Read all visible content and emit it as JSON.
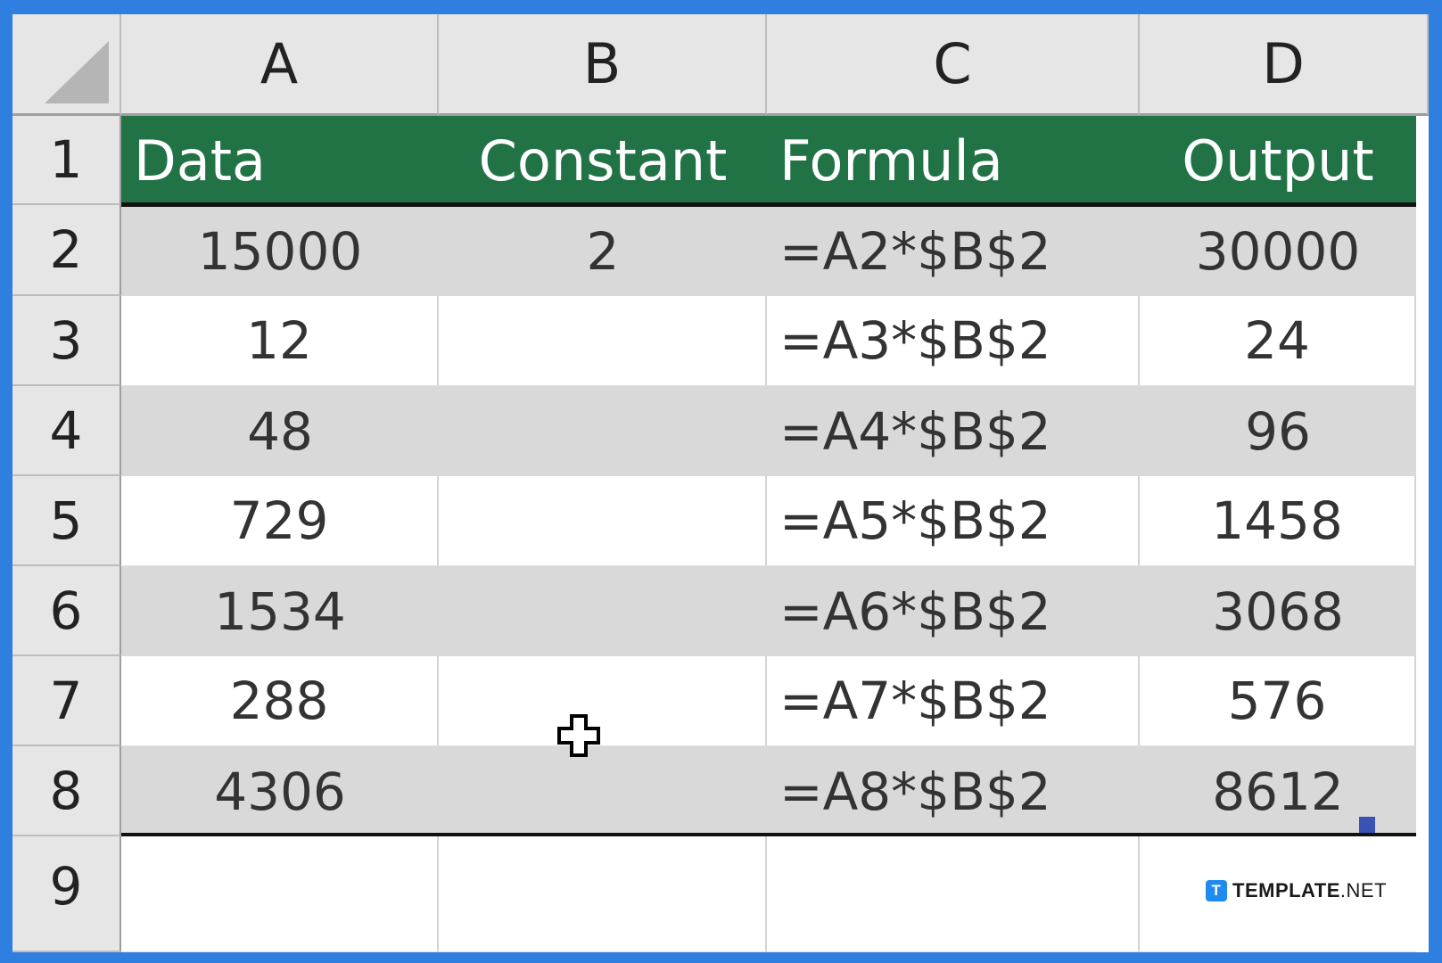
{
  "columns": [
    "A",
    "B",
    "C",
    "D"
  ],
  "rows": [
    "1",
    "2",
    "3",
    "4",
    "5",
    "6",
    "7",
    "8",
    "9"
  ],
  "header_row": {
    "a": "Data",
    "b": "Constant",
    "c": "Formula",
    "d": "Output"
  },
  "data_rows": [
    {
      "a": "15000",
      "b": "2",
      "c": "=A2*$B$2",
      "d": "30000"
    },
    {
      "a": "12",
      "b": "",
      "c": "=A3*$B$2",
      "d": "24"
    },
    {
      "a": "48",
      "b": "",
      "c": "=A4*$B$2",
      "d": "96"
    },
    {
      "a": "729",
      "b": "",
      "c": "=A5*$B$2",
      "d": "1458"
    },
    {
      "a": "1534",
      "b": "",
      "c": "=A6*$B$2",
      "d": "3068"
    },
    {
      "a": "288",
      "b": "",
      "c": "=A7*$B$2",
      "d": "576"
    },
    {
      "a": "4306",
      "b": "",
      "c": "=A8*$B$2",
      "d": "8612"
    }
  ],
  "watermark": {
    "mark": "T",
    "brand": "TEMPLATE",
    "suffix": ".NET"
  },
  "colors": {
    "header_green": "#217346",
    "frame_blue": "#2f7fe0",
    "band_gray": "#d9d9d9"
  }
}
